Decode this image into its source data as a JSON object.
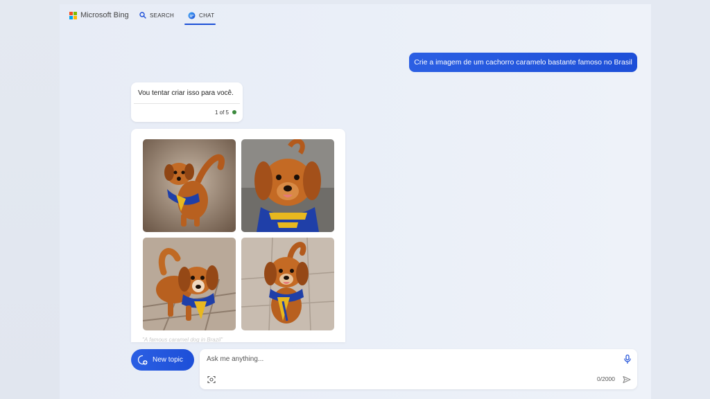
{
  "header": {
    "brand": "Microsoft Bing",
    "brand_colors": [
      "#f25022",
      "#7fba00",
      "#00a4ef",
      "#ffb900"
    ],
    "nav": {
      "search_label": "SEARCH",
      "chat_label": "CHAT"
    },
    "accent": "#1d4fd8"
  },
  "conversation": {
    "user_message": "Crie a imagem de um cachorro caramelo bastante famoso no Brasil",
    "bot_message": "Vou tentar criar isso para você.",
    "bot_counter": "1 of 5",
    "image_caption": "\"A famous caramel dog in Brazil\"",
    "images": [
      "dog-image-1",
      "dog-image-2",
      "dog-image-3",
      "dog-image-4"
    ]
  },
  "composer": {
    "new_topic_label": "New topic",
    "placeholder": "Ask me anything...",
    "char_count": "0/2000"
  }
}
